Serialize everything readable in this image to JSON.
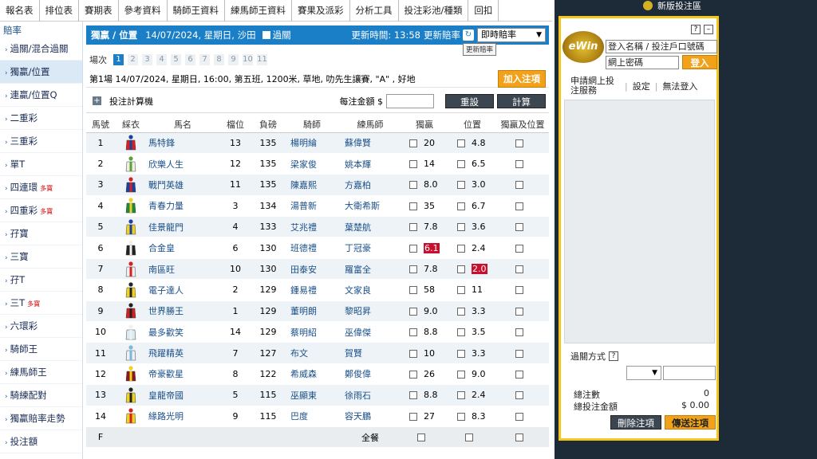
{
  "nav": [
    "報名表",
    "排位表",
    "賽期表",
    "參考資料",
    "騎師王資料",
    "練馬師王資料",
    "賽果及派彩",
    "分析工具",
    "投注彩池/種類",
    "回扣"
  ],
  "sidebar": {
    "title": "賠率",
    "items": [
      {
        "label": "過關/混合過關",
        "badge": ""
      },
      {
        "label": "獨贏/位置",
        "badge": ""
      },
      {
        "label": "連贏/位置Q",
        "badge": ""
      },
      {
        "label": "二重彩",
        "badge": ""
      },
      {
        "label": "三重彩",
        "badge": ""
      },
      {
        "label": "單T",
        "badge": ""
      },
      {
        "label": "四連環",
        "badge": "多寶"
      },
      {
        "label": "四重彩",
        "badge": "多寶"
      },
      {
        "label": "孖寶",
        "badge": ""
      },
      {
        "label": "三寶",
        "badge": ""
      },
      {
        "label": "孖T",
        "badge": ""
      },
      {
        "label": "三T",
        "badge": "多寶"
      },
      {
        "label": "六環彩",
        "badge": ""
      },
      {
        "label": "騎師王",
        "badge": ""
      },
      {
        "label": "練馬師王",
        "badge": ""
      },
      {
        "label": "騎練配對",
        "badge": ""
      },
      {
        "label": "獨贏賠率走勢",
        "badge": ""
      },
      {
        "label": "投注額",
        "badge": ""
      }
    ]
  },
  "header": {
    "title": "獨贏 / 位置",
    "date": "14/07/2024, 星期日, 沙田",
    "parlay": "過關",
    "update": "更新時間: 13:58",
    "refresh_label": "更新賠率",
    "odds_mode": "即時賠率",
    "tooltip": "更新賠率"
  },
  "race": {
    "label": "場次",
    "numbers": [
      "1",
      "2",
      "3",
      "4",
      "5",
      "6",
      "7",
      "8",
      "9",
      "10",
      "11"
    ],
    "info": "第1場   14/07/2024, 星期日, 16:00, 第五班, 1200米, 草地, 叻先生讓賽, \"A\" , 好地",
    "add_btn": "加入注項"
  },
  "calc": {
    "label": "投注計算機",
    "per_bet": "每注金額 $",
    "reset": "重設",
    "compute": "計算"
  },
  "columns": [
    "馬號",
    "綵衣",
    "馬名",
    "檔位",
    "負磅",
    "騎師",
    "練馬師",
    "獨贏",
    "位置",
    "獨贏及位置"
  ],
  "runners": [
    {
      "no": "1",
      "name": "馬特鋒",
      "draw": "13",
      "wt": "135",
      "jockey": "楊明綸",
      "trainer": "蘇偉賢",
      "win": "20",
      "place": "4.8",
      "win_hot": false,
      "place_hot": false,
      "silk": [
        "#d42020",
        "#1a3fa0"
      ]
    },
    {
      "no": "2",
      "name": "欣樂人生",
      "draw": "12",
      "wt": "135",
      "jockey": "梁家俊",
      "trainer": "姚本輝",
      "win": "14",
      "place": "6.5",
      "win_hot": false,
      "place_hot": false,
      "silk": [
        "#f0f0e0",
        "#5aa03c"
      ]
    },
    {
      "no": "3",
      "name": "戰鬥英雄",
      "draw": "11",
      "wt": "135",
      "jockey": "陳嘉熙",
      "trainer": "方嘉柏",
      "win": "8.0",
      "place": "3.0",
      "win_hot": false,
      "place_hot": false,
      "silk": [
        "#1a3fa0",
        "#d42020"
      ]
    },
    {
      "no": "4",
      "name": "青春力量",
      "draw": "3",
      "wt": "134",
      "jockey": "湯普新",
      "trainer": "大衛希斯",
      "win": "35",
      "place": "6.7",
      "win_hot": false,
      "place_hot": false,
      "silk": [
        "#1d8a3a",
        "#f0d020"
      ]
    },
    {
      "no": "5",
      "name": "佳景龍門",
      "draw": "4",
      "wt": "133",
      "jockey": "艾兆禮",
      "trainer": "葉楚航",
      "win": "7.8",
      "place": "3.6",
      "win_hot": false,
      "place_hot": false,
      "silk": [
        "#f0d020",
        "#1a3fa0"
      ]
    },
    {
      "no": "6",
      "name": "合金皇",
      "draw": "6",
      "wt": "130",
      "jockey": "班德禮",
      "trainer": "丁冠豪",
      "win": "6.1",
      "place": "2.4",
      "win_hot": true,
      "place_hot": false,
      "silk": [
        "#222222",
        "#f0f0f0"
      ]
    },
    {
      "no": "7",
      "name": "南區旺",
      "draw": "10",
      "wt": "130",
      "jockey": "田泰安",
      "trainer": "羅富全",
      "win": "7.8",
      "place": "2.0",
      "win_hot": false,
      "place_hot": true,
      "silk": [
        "#f0f0f0",
        "#d42020"
      ]
    },
    {
      "no": "8",
      "name": "電子達人",
      "draw": "2",
      "wt": "129",
      "jockey": "鍾易禮",
      "trainer": "文家良",
      "win": "58",
      "place": "11",
      "win_hot": false,
      "place_hot": false,
      "silk": [
        "#f0d020",
        "#222222"
      ]
    },
    {
      "no": "9",
      "name": "世界勝王",
      "draw": "1",
      "wt": "129",
      "jockey": "董明朗",
      "trainer": "黎昭昇",
      "win": "9.0",
      "place": "3.3",
      "win_hot": false,
      "place_hot": false,
      "silk": [
        "#d42020",
        "#222222"
      ]
    },
    {
      "no": "10",
      "name": "最多歡笑",
      "draw": "14",
      "wt": "129",
      "jockey": "蔡明紹",
      "trainer": "巫偉傑",
      "win": "8.8",
      "place": "3.5",
      "win_hot": false,
      "place_hot": false,
      "silk": [
        "#d8ecf4",
        "#f0f0f0"
      ]
    },
    {
      "no": "11",
      "name": "飛躍精英",
      "draw": "7",
      "wt": "127",
      "jockey": "布文",
      "trainer": "賀賢",
      "win": "10",
      "place": "3.3",
      "win_hot": false,
      "place_hot": false,
      "silk": [
        "#f0f0f0",
        "#78b8e0"
      ]
    },
    {
      "no": "12",
      "name": "帝豪歡星",
      "draw": "8",
      "wt": "122",
      "jockey": "希威森",
      "trainer": "鄭俊偉",
      "win": "26",
      "place": "9.0",
      "win_hot": false,
      "place_hot": false,
      "silk": [
        "#8a1a1a",
        "#f0d020"
      ]
    },
    {
      "no": "13",
      "name": "皇龍帝國",
      "draw": "5",
      "wt": "115",
      "jockey": "巫顯東",
      "trainer": "徐雨石",
      "win": "8.8",
      "place": "2.4",
      "win_hot": false,
      "place_hot": false,
      "silk": [
        "#f0d020",
        "#222222"
      ]
    },
    {
      "no": "14",
      "name": "緣路光明",
      "draw": "9",
      "wt": "115",
      "jockey": "巴度",
      "trainer": "容天鵬",
      "win": "27",
      "place": "8.3",
      "win_hot": false,
      "place_hot": false,
      "silk": [
        "#f0d020",
        "#d42020"
      ]
    }
  ],
  "field_row": {
    "no": "F",
    "label": "全餐"
  },
  "right": {
    "new_site": "新版投注區",
    "logo": "eWin",
    "username_placeholder": "登入名稱 / 投注戶口號碼",
    "password_placeholder": "網上密碼",
    "login": "登入",
    "apply": "申請網上投注服務",
    "settings": "設定",
    "no_login": "無法登入",
    "parlay_mode": "過關方式",
    "total_bets_label": "總注數",
    "total_bets": "0",
    "total_amount_label": "總投注金額",
    "total_amount": "$ 0.00",
    "delete": "刪除注項",
    "send": "傳送注項"
  }
}
